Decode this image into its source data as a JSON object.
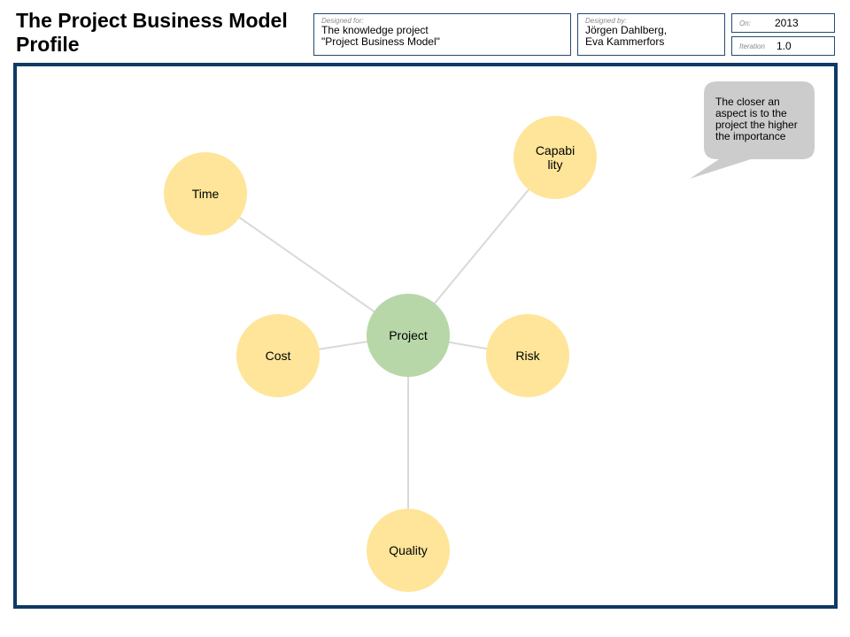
{
  "header": {
    "title": "The Project Business Model Profile",
    "designed_for": {
      "label": "Designed for:",
      "lines": [
        "The knowledge project",
        "\"Project Business Model\""
      ]
    },
    "designed_by": {
      "label": "Designed by:",
      "lines": [
        "Jörgen Dahlberg,",
        "Eva Kammerfors"
      ]
    },
    "on": {
      "label": "On:",
      "value": "2013"
    },
    "iteration": {
      "label": "Iteration",
      "value": "1.0"
    }
  },
  "colors": {
    "frame": "#0f3a64",
    "box_border": "#234a72",
    "aspect_fill": "#fee599",
    "center_fill": "#b7d7a8",
    "connector": "#d9d9d9",
    "callout_fill": "#cccccc"
  },
  "diagram": {
    "center": {
      "id": "project",
      "label": "Project"
    },
    "aspects": [
      {
        "id": "time",
        "label_lines": [
          "Time"
        ]
      },
      {
        "id": "capability",
        "label_lines": [
          "Capabi",
          "lity"
        ]
      },
      {
        "id": "cost",
        "label_lines": [
          "Cost"
        ]
      },
      {
        "id": "risk",
        "label_lines": [
          "Risk"
        ]
      },
      {
        "id": "quality",
        "label_lines": [
          "Quality"
        ]
      }
    ],
    "callout": {
      "lines": [
        "The closer an",
        "aspect is to the",
        "project the higher",
        "the importance"
      ]
    }
  }
}
